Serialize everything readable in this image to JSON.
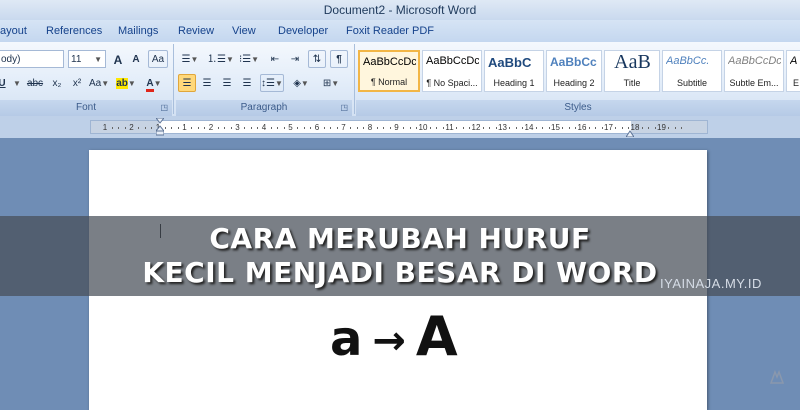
{
  "window": {
    "title": "Document2 - Microsoft Word"
  },
  "tabs": [
    {
      "label": "ayout"
    },
    {
      "label": "References"
    },
    {
      "label": "Mailings"
    },
    {
      "label": "Review"
    },
    {
      "label": "View"
    },
    {
      "label": "Developer"
    },
    {
      "label": "Foxit Reader PDF"
    }
  ],
  "font_group": {
    "label": "Font",
    "font_name": "ody)",
    "font_size": "11",
    "grow_label": "A",
    "shrink_label": "A",
    "clear_label": "Aa",
    "strike_label": "abc",
    "subscript_label": "x₂",
    "superscript_label": "x²",
    "case_label": "Aa",
    "highlight_label": "ab",
    "color_label": "A"
  },
  "paragraph_group": {
    "label": "Paragraph"
  },
  "styles_group": {
    "label": "Styles",
    "items": [
      {
        "sample": "AaBbCcDc",
        "name": "¶ Normal"
      },
      {
        "sample": "AaBbCcDc",
        "name": "¶ No Spaci..."
      },
      {
        "sample": "AaBbC",
        "name": "Heading 1"
      },
      {
        "sample": "AaBbCc",
        "name": "Heading 2"
      },
      {
        "sample": "AaB",
        "name": "Title"
      },
      {
        "sample": "AaBbCc.",
        "name": "Subtitle"
      },
      {
        "sample": "AaBbCcDc",
        "name": "Subtle Em..."
      },
      {
        "sample": "A",
        "name": "E"
      }
    ]
  },
  "ruler": {
    "numbers": [
      "1",
      "2",
      "1",
      "1",
      "2",
      "3",
      "4",
      "5",
      "6",
      "7",
      "8",
      "9",
      "10",
      "11",
      "12",
      "13",
      "14",
      "15",
      "16",
      "17",
      "18",
      "19"
    ]
  },
  "banner": {
    "line1": "CARA MERUBAH HURUF",
    "line2": "KECIL MENJADI BESAR DI WORD",
    "watermark": "IYAINAJA.MY.ID"
  },
  "demo": {
    "lower": "a",
    "arrow": "→",
    "upper": "A"
  },
  "colors": {
    "accent": "#f2b646",
    "ribbon_text": "#15428b",
    "banner_bg": "#464e58"
  }
}
